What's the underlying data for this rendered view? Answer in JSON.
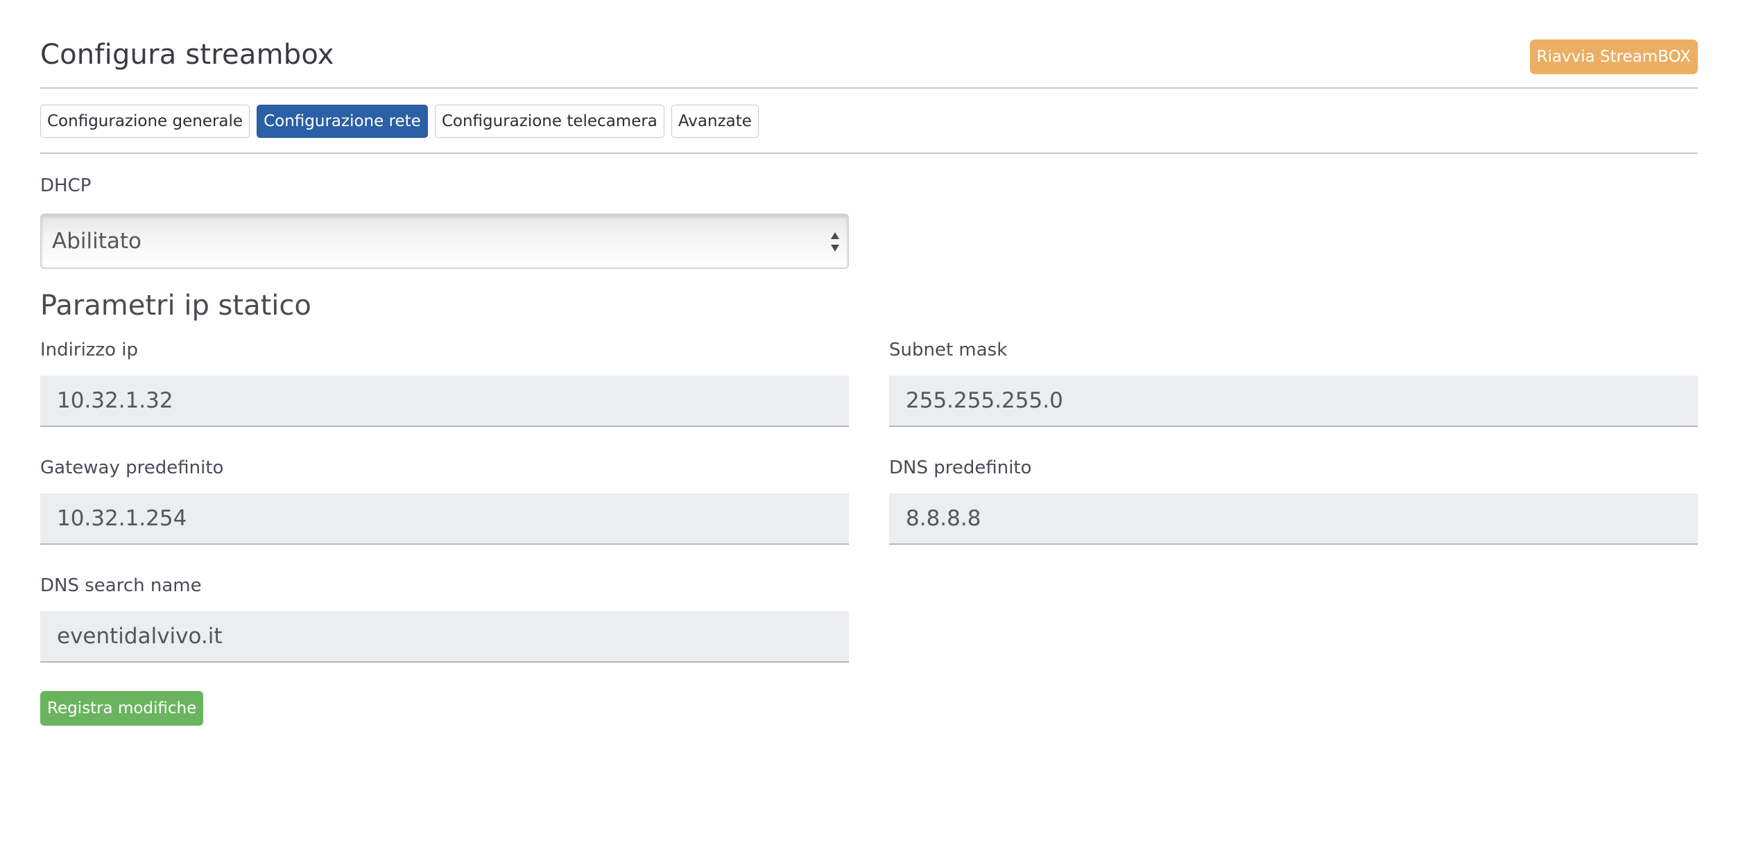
{
  "header": {
    "title": "Configura streambox",
    "restart_label": "Riavvia StreamBOX"
  },
  "tabs": [
    {
      "label": "Configurazione generale",
      "active": false
    },
    {
      "label": "Configurazione rete",
      "active": true
    },
    {
      "label": "Configurazione telecamera",
      "active": false
    },
    {
      "label": "Avanzate",
      "active": false
    }
  ],
  "dhcp": {
    "label": "DHCP",
    "selected": "Abilitato"
  },
  "static_ip": {
    "title": "Parametri ip statico",
    "ip_label": "Indirizzo ip",
    "ip_value": "10.32.1.32",
    "subnet_label": "Subnet mask",
    "subnet_value": "255.255.255.0",
    "gateway_label": "Gateway predefinito",
    "gateway_value": "10.32.1.254",
    "dns_label": "DNS predefinito",
    "dns_value": "8.8.8.8",
    "search_label": "DNS search name",
    "search_value": "eventidalvivo.it"
  },
  "actions": {
    "save_label": "Registra modifiche"
  },
  "colors": {
    "accent_blue": "#2b5fa6",
    "restart_orange": "#ebae62",
    "save_green": "#6ab45f"
  },
  "icons": {
    "select": "up-down-arrows-icon"
  }
}
